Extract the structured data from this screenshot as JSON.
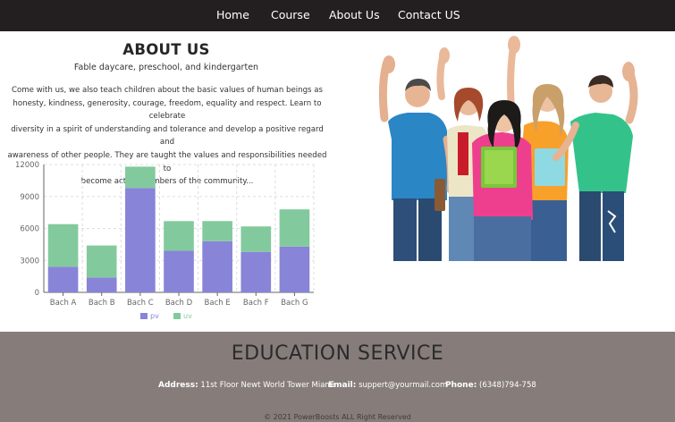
{
  "nav": {
    "items": [
      {
        "label": "Home"
      },
      {
        "label": "Course"
      },
      {
        "label": "About Us"
      },
      {
        "label": "Contact US"
      }
    ]
  },
  "about": {
    "title": "ABOUT US",
    "subtitle": "Fable daycare, preschool, and kindergarten",
    "body_lines": [
      "Come with us, we also teach children about the basic values of human beings as",
      "honesty, kindness, generosity, courage, freedom, equality and respect. Learn to celebrate",
      "diversity in a spirit of understanding and tolerance and develop a positive regard and",
      "awareness of other people. They are taught the values and responsibilities needed to",
      "become active members of the community..."
    ]
  },
  "chart_data": {
    "type": "bar",
    "stacked": true,
    "categories": [
      "Bach A",
      "Bach B",
      "Bach C",
      "Bach D",
      "Bach E",
      "Bach F",
      "Bach G"
    ],
    "series": [
      {
        "name": "pv",
        "color": "#8884d8",
        "values": [
          2400,
          1400,
          9800,
          3908,
          4800,
          3800,
          4300
        ]
      },
      {
        "name": "uv",
        "color": "#82ca9d",
        "values": [
          4000,
          3000,
          2000,
          2780,
          1890,
          2390,
          3490
        ]
      }
    ],
    "yticks": [
      "0",
      "3000",
      "6000",
      "9000",
      "12000"
    ],
    "ylim": [
      0,
      12000
    ],
    "grid": "dashed",
    "legend": "bottom"
  },
  "footer": {
    "title": "EDUCATION SERVICE",
    "address_label": "Address:",
    "address_value": "11st Floor Newt World Tower Miami",
    "email_label": "Email:",
    "email_value": "suppert@yourmail.com",
    "phone_label": "Phone:",
    "phone_value": "(6348)794-758",
    "copyright": "© 2021 PowerBoosts ALL Right Reserved"
  },
  "colors": {
    "nav_bg": "#231f20",
    "footer_bg": "#867d7b",
    "pv": "#8884d8",
    "uv": "#82ca9d"
  }
}
